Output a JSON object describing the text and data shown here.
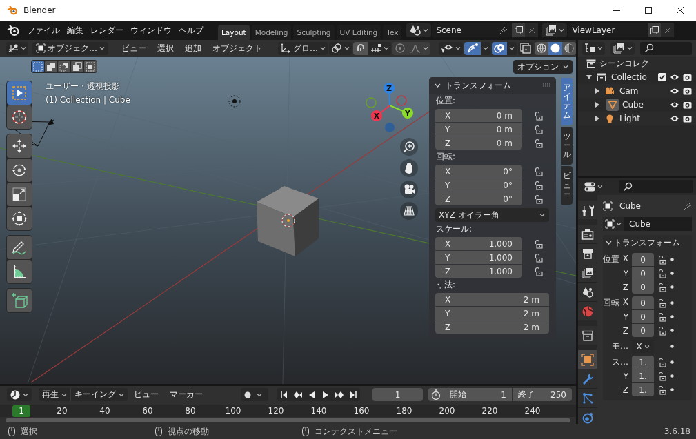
{
  "window": {
    "title": "Blender"
  },
  "menus": [
    "ファイル",
    "編集",
    "レンダー",
    "ウィンドウ",
    "ヘルプ"
  ],
  "workspaces": [
    {
      "label": "Layout",
      "selected": true
    },
    {
      "label": "Modeling",
      "selected": false
    },
    {
      "label": "Sculpting",
      "selected": false
    },
    {
      "label": "UV Editing",
      "selected": false
    },
    {
      "label": "Tex",
      "selected": false
    }
  ],
  "scene": {
    "value": "Scene"
  },
  "view_layer": {
    "value": "ViewLayer"
  },
  "viewport": {
    "mode": "オブジェク…",
    "menus": [
      "ビュー",
      "選択",
      "追加",
      "オブジェクト"
    ],
    "orientation": "グロ…",
    "toggles": [
      {
        "kind": "gizmo",
        "on": true
      },
      {
        "kind": "overlay",
        "on": true
      },
      {
        "kind": "xray",
        "on": false
      }
    ],
    "shading": [
      {
        "kind": "wireframe",
        "selected": false
      },
      {
        "kind": "solid",
        "selected": true
      },
      {
        "kind": "material",
        "selected": false
      }
    ],
    "select_modes": [
      {
        "selected": true
      },
      {
        "selected": false
      },
      {
        "selected": false
      },
      {
        "selected": false
      },
      {
        "selected": false
      }
    ],
    "options": "オプション",
    "info": [
      "ユーザー・透視投影",
      "(1) Collection | Cube"
    ],
    "tool_groups": [
      {
        "tools": [
          {
            "kind": "select",
            "selected": true
          },
          {
            "kind": "cursor",
            "selected": false
          }
        ]
      },
      {
        "tools": [
          {
            "kind": "move",
            "selected": false
          },
          {
            "kind": "rotate",
            "selected": false
          },
          {
            "kind": "scale",
            "selected": false
          },
          {
            "kind": "transform",
            "selected": false
          }
        ]
      },
      {
        "tools": [
          {
            "kind": "annotate",
            "selected": false
          },
          {
            "kind": "measure",
            "selected": false
          }
        ]
      },
      {
        "tools": [
          {
            "kind": "add_cube",
            "selected": false
          }
        ]
      }
    ],
    "gizmo": [
      {
        "label": "Z",
        "color": "#2d84e4"
      },
      {
        "label": "Y",
        "color": "#8bdc2a"
      },
      {
        "label": "X",
        "color": "#f0364f"
      }
    ],
    "nav": [
      {
        "kind": "zoom"
      },
      {
        "kind": "pan"
      },
      {
        "kind": "camera"
      },
      {
        "kind": "ortho"
      }
    ],
    "sidebar_tabs": [
      {
        "label": "アイテム",
        "selected": true
      },
      {
        "label": "ツール",
        "selected": false
      },
      {
        "label": "ビュー",
        "selected": false
      }
    ],
    "transform": {
      "title": "トランスフォーム",
      "sections": [
        {
          "label": "位置:",
          "locks": true,
          "rows": [
            {
              "axis": "X",
              "value": "0 m"
            },
            {
              "axis": "Y",
              "value": "0 m"
            },
            {
              "axis": "Z",
              "value": "0 m"
            }
          ]
        },
        {
          "label": "回転:",
          "locks": true,
          "rows": [
            {
              "axis": "X",
              "value": "0°"
            },
            {
              "axis": "Y",
              "value": "0°"
            },
            {
              "axis": "Z",
              "value": "0°"
            }
          ],
          "mode": "XYZ オイラー角"
        },
        {
          "label": "スケール:",
          "locks": true,
          "rows": [
            {
              "axis": "X",
              "value": "1.000"
            },
            {
              "axis": "Y",
              "value": "1.000"
            },
            {
              "axis": "Z",
              "value": "1.000"
            }
          ]
        },
        {
          "label": "寸法:",
          "locks": false,
          "rows": [
            {
              "axis": "X",
              "value": "2 m"
            },
            {
              "axis": "Y",
              "value": "2 m"
            },
            {
              "axis": "Z",
              "value": "2 m"
            }
          ]
        }
      ]
    }
  },
  "timeline": {
    "playback": "再生",
    "keying": "キーイング",
    "menus": [
      "ビュー",
      "マーカー"
    ],
    "current_frame": "1",
    "start_label": "開始",
    "start": "1",
    "end_label": "終了",
    "end": "250",
    "playhead": "1",
    "ruler": [
      "20",
      "40",
      "60",
      "80",
      "100",
      "120",
      "140",
      "160",
      "180",
      "200",
      "220",
      "240"
    ]
  },
  "outliner": {
    "root": "シーンコレク",
    "items": [
      {
        "label": "Collectio",
        "kind": "collection",
        "expanded": true,
        "checked": true,
        "selected": false,
        "children": [
          {
            "label": "Cam",
            "kind": "camera",
            "expanded": false,
            "selected": false
          },
          {
            "label": "Cube",
            "kind": "mesh",
            "expanded": false,
            "selected": true
          },
          {
            "label": "Light",
            "kind": "light",
            "expanded": false,
            "selected": false
          }
        ]
      }
    ]
  },
  "properties": {
    "tab_groups": [
      {
        "tabs": [
          {
            "kind": "tool",
            "selected": false
          }
        ]
      },
      {
        "tabs": [
          {
            "kind": "render",
            "selected": false
          },
          {
            "kind": "output",
            "selected": false
          },
          {
            "kind": "view_layer",
            "selected": false
          },
          {
            "kind": "scene",
            "selected": false
          },
          {
            "kind": "world",
            "selected": false
          }
        ]
      },
      {
        "tabs": [
          {
            "kind": "collection",
            "selected": false
          }
        ]
      },
      {
        "tabs": [
          {
            "kind": "object",
            "selected": true
          },
          {
            "kind": "modifiers",
            "selected": false
          },
          {
            "kind": "particles",
            "selected": false
          },
          {
            "kind": "physics",
            "selected": false
          }
        ]
      }
    ],
    "object": "Cube",
    "name": "Cube",
    "section": "トランスフォーム",
    "groups": [
      {
        "rows": [
          {
            "kind": "number",
            "label": "位置",
            "axis": "X",
            "value": "0"
          },
          {
            "kind": "number",
            "axis": "Y",
            "value": "0"
          },
          {
            "kind": "number",
            "axis": "Z",
            "value": "0"
          }
        ]
      },
      {
        "rows": [
          {
            "kind": "number",
            "label": "回転",
            "axis": "X",
            "value": "0"
          },
          {
            "kind": "number",
            "axis": "Y",
            "value": "0"
          },
          {
            "kind": "number",
            "axis": "Z",
            "value": "0"
          }
        ]
      },
      {
        "rows": [
          {
            "kind": "dropdown",
            "label": "モ…",
            "value": "X"
          }
        ]
      },
      {
        "rows": [
          {
            "kind": "number",
            "label": "ス…",
            "value": "1."
          },
          {
            "kind": "number",
            "axis": "Y",
            "value": "1."
          },
          {
            "kind": "number",
            "axis": "Z",
            "value": "1."
          }
        ]
      }
    ]
  },
  "status_bar": {
    "items": [
      "選択",
      "視点の移動",
      "コンテクストメニュー"
    ],
    "version": "3.6.18"
  }
}
